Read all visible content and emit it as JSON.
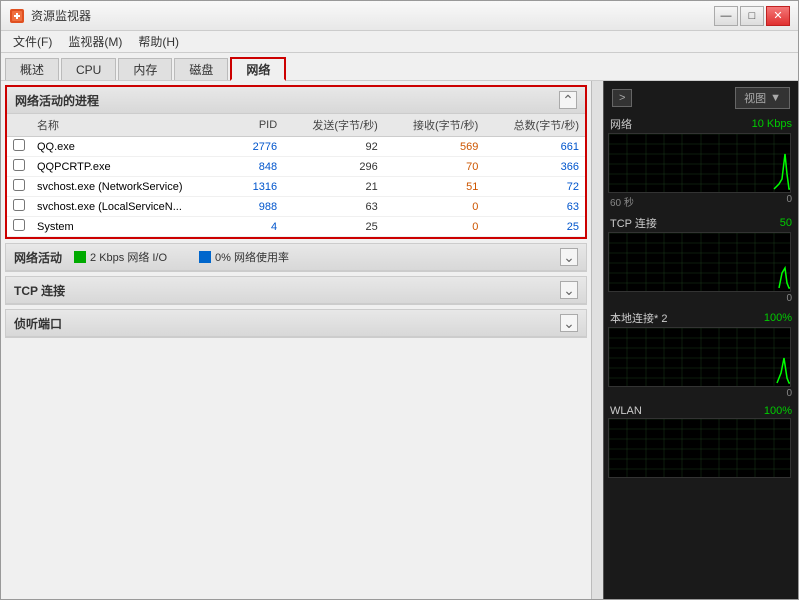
{
  "window": {
    "title": "资源监视器",
    "icon": "monitor-icon"
  },
  "title_controls": {
    "minimize": "—",
    "maximize": "□",
    "close": "✕"
  },
  "menu": {
    "items": [
      "文件(F)",
      "监视器(M)",
      "帮助(H)"
    ]
  },
  "tabs": [
    {
      "label": "概述",
      "active": false
    },
    {
      "label": "CPU",
      "active": false
    },
    {
      "label": "内存",
      "active": false
    },
    {
      "label": "磁盘",
      "active": false
    },
    {
      "label": "网络",
      "active": true
    }
  ],
  "sections": {
    "network_processes": {
      "title": "网络活动的进程",
      "columns": [
        "名称",
        "PID",
        "发送(字节/秒)",
        "接收(字节/秒)",
        "总数(字节/秒)"
      ],
      "rows": [
        {
          "name": "QQ.exe",
          "pid": "2776",
          "send": "92",
          "recv": "569",
          "total": "661"
        },
        {
          "name": "QQPCRTP.exe",
          "pid": "848",
          "send": "296",
          "recv": "70",
          "total": "366"
        },
        {
          "name": "svchost.exe (NetworkService)",
          "pid": "1316",
          "send": "21",
          "recv": "51",
          "total": "72"
        },
        {
          "name": "svchost.exe (LocalServiceN...",
          "pid": "988",
          "send": "63",
          "recv": "0",
          "total": "63"
        },
        {
          "name": "System",
          "pid": "4",
          "send": "25",
          "recv": "0",
          "total": "25"
        }
      ]
    },
    "network_activity": {
      "title": "网络活动",
      "indicators": [
        {
          "color": "green",
          "text": "2 Kbps 网络 I/O"
        },
        {
          "color": "blue",
          "text": "0% 网络使用率"
        }
      ]
    },
    "tcp_connections": {
      "title": "TCP 连接"
    },
    "listening_ports": {
      "title": "侦听端口"
    }
  },
  "right_panel": {
    "nav_label": ">",
    "view_label": "视图",
    "charts": [
      {
        "label": "网络",
        "value": "10 Kbps",
        "time_label": "60 秒",
        "zero": "0"
      },
      {
        "label": "TCP 连接",
        "value": "50",
        "time_label": "",
        "zero": "0"
      },
      {
        "label": "本地连接* 2",
        "value": "100%",
        "time_label": "",
        "zero": "0"
      },
      {
        "label": "WLAN",
        "value": "100%",
        "time_label": "",
        "zero": ""
      }
    ]
  }
}
